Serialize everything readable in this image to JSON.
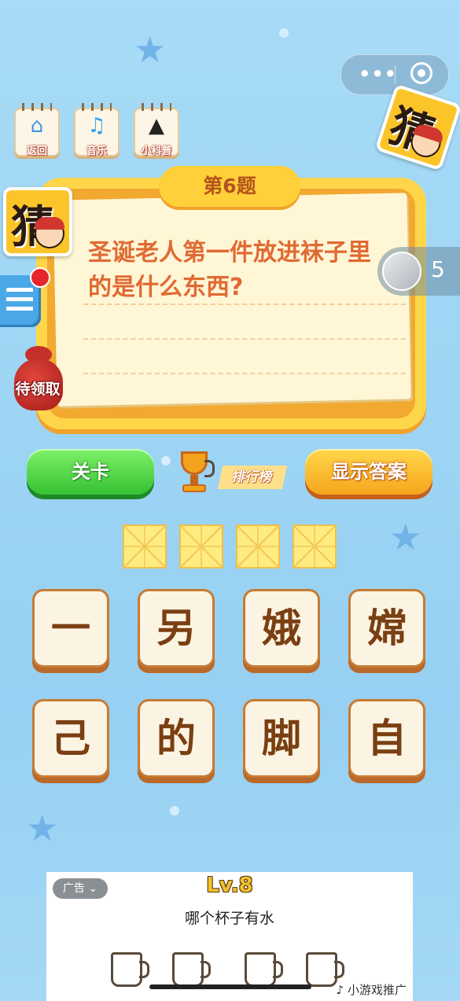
{
  "topbar": {
    "more_icon": "more-dots-icon",
    "close_icon": "target-circle-icon"
  },
  "tools": [
    {
      "label": "返回",
      "icon": "home-icon"
    },
    {
      "label": "音乐",
      "icon": "music-note-icon"
    },
    {
      "label": "小科普",
      "icon": "graduation-cap-icon"
    }
  ],
  "logo_char": "猜",
  "sidebar": {
    "reward_label": "待领取"
  },
  "question": {
    "level_label": "第6题",
    "text": "圣诞老人第一件放进袜子里的是什么东西?"
  },
  "players": {
    "count": "5"
  },
  "actions": {
    "levels_label": "关卡",
    "rank_label": "排行榜",
    "show_answer_label": "显示答案"
  },
  "answer_slots": [
    "",
    "",
    "",
    ""
  ],
  "choices": [
    "一",
    "另",
    "娥",
    "嫦",
    "己",
    "的",
    "脚",
    "自"
  ],
  "ad": {
    "tag": "广告 ⌄",
    "level": "Lv.8",
    "title": "哪个杯子有水",
    "brand": "♪ 小游戏推广"
  },
  "colors": {
    "background": "#9fd6f5",
    "card": "#ffd64a",
    "question_text": "#e06a33",
    "green_button": "#35c232",
    "orange_button": "#f6a51d"
  }
}
